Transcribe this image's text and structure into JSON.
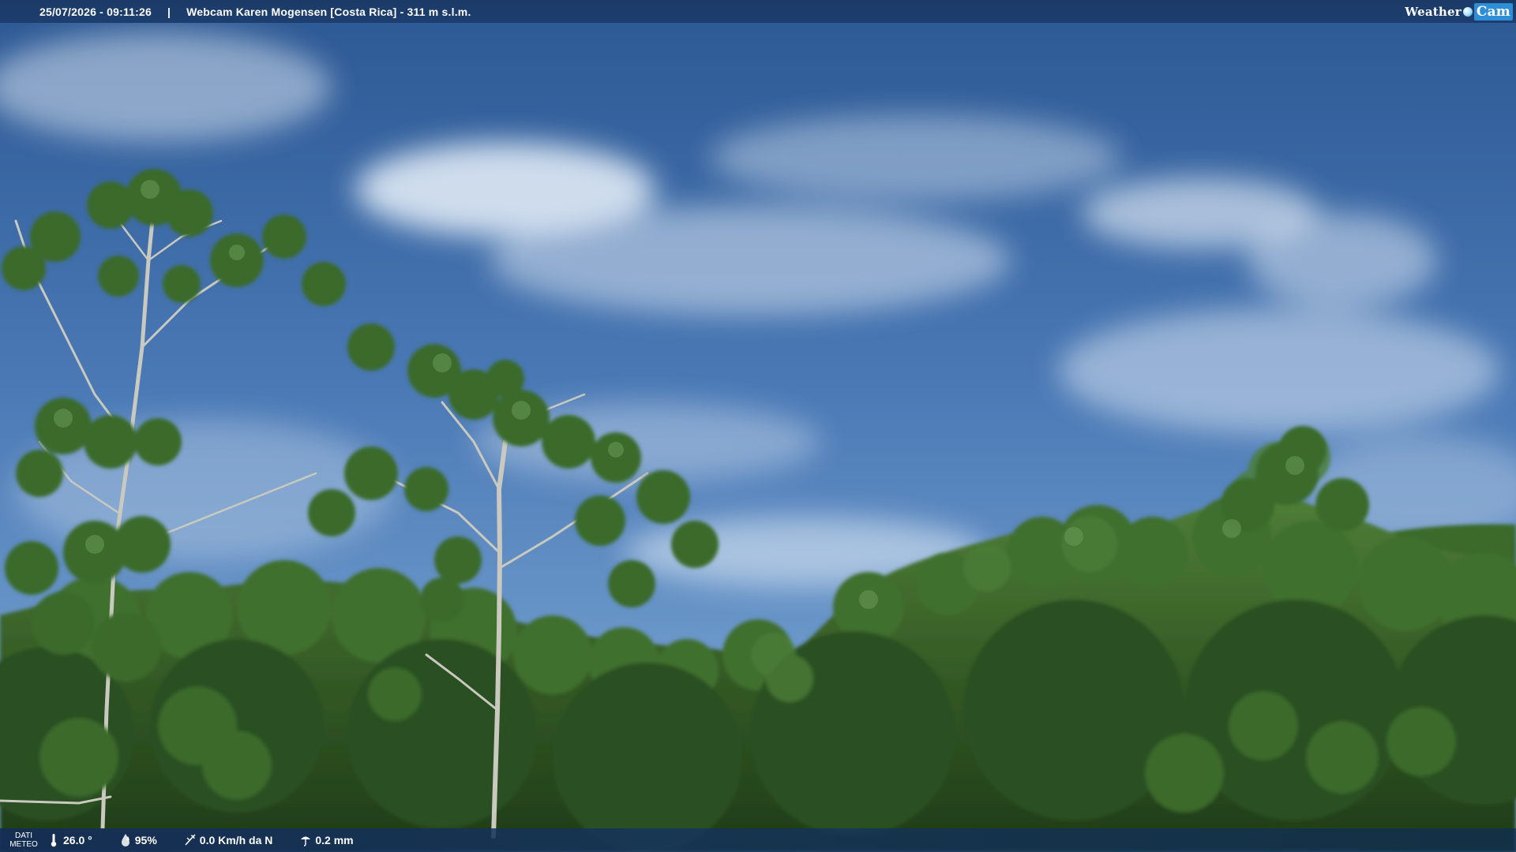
{
  "header": {
    "datetime": "25/07/2026 - 09:11:26",
    "separator": "|",
    "title": "Webcam Karen Mogensen [Costa Rica]  - 311 m s.l.m.",
    "brand_word": "Weather",
    "brand_cam": "Cam"
  },
  "footer": {
    "label_line1": "DATI",
    "label_line2": "METEO",
    "temperature": "26.0 °",
    "humidity": "95%",
    "wind": "0.0 Km/h da N",
    "rain": "0.2 mm"
  },
  "icons": [
    "thermometer-icon",
    "humidity-drop-icon",
    "wind-icon",
    "rain-icon"
  ],
  "colors": {
    "sky_top": "#2f5d9a",
    "sky_bottom": "#7fa7d4",
    "vegetation": "#3d6a2c",
    "bar": "#1b3a67",
    "brand_accent": "#2f8fd6"
  }
}
